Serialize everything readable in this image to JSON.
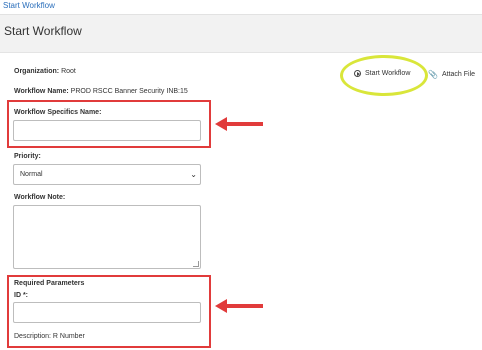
{
  "breadcrumb": {
    "link": "Start Workflow"
  },
  "header": {
    "title": "Start Workflow"
  },
  "info": {
    "organization_label": "Organization:",
    "organization_value": "Root",
    "workflow_name_label": "Workflow Name:",
    "workflow_name_value": "PROD RSCC Banner Security INB:15"
  },
  "form": {
    "specifics_label": "Workflow Specifics Name:",
    "specifics_value": "",
    "priority_label": "Priority:",
    "priority_value": "Normal",
    "note_label": "Workflow Note:",
    "note_value": ""
  },
  "required": {
    "heading": "Required Parameters",
    "id_label": "ID *:",
    "id_value": "",
    "description": "Description: R Number"
  },
  "actions": {
    "start_workflow": "Start Workflow",
    "attach_file": "Attach File"
  },
  "annotation_colors": {
    "red_box": "#e13b3b",
    "highlight": "#d9e63a"
  }
}
